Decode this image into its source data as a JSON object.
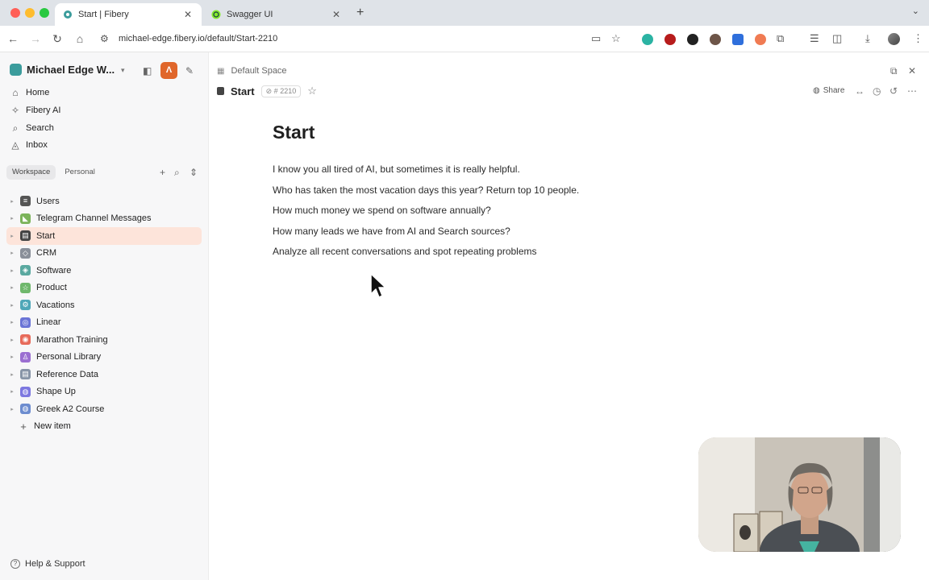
{
  "browser": {
    "tabs": [
      {
        "title": "Start | Fibery",
        "close": "✕"
      },
      {
        "title": "Swagger UI",
        "close": "✕"
      }
    ],
    "new_tab": "+",
    "url": "michael-edge.fibery.io/default/Start-2210"
  },
  "sidebar": {
    "workspace_name": "Michael Edge W...",
    "ai_button": "Λ",
    "menu": [
      {
        "label": "Home",
        "icon": "home-icon"
      },
      {
        "label": "Fibery AI",
        "icon": "sparkle-icon"
      },
      {
        "label": "Search",
        "icon": "search-icon"
      },
      {
        "label": "Inbox",
        "icon": "bell-icon"
      }
    ],
    "tabs": {
      "workspace": "Workspace",
      "personal": "Personal"
    },
    "tree": [
      {
        "label": "Users",
        "color": "#555555"
      },
      {
        "label": "Telegram Channel Messages",
        "color": "#7bb35a"
      },
      {
        "label": "Start",
        "color": "#444444"
      },
      {
        "label": "CRM",
        "color": "#8a8f99"
      },
      {
        "label": "Software",
        "color": "#5aa9a0"
      },
      {
        "label": "Product",
        "color": "#6fb86c"
      },
      {
        "label": "Vacations",
        "color": "#4fa7b8"
      },
      {
        "label": "Linear",
        "color": "#6a74d6"
      },
      {
        "label": "Marathon Training",
        "color": "#e76a5a"
      },
      {
        "label": "Personal Library",
        "color": "#9b6fd1"
      },
      {
        "label": "Reference Data",
        "color": "#8895a7"
      },
      {
        "label": "Shape Up",
        "color": "#7d78e0"
      },
      {
        "label": "Greek A2 Course",
        "color": "#6c8ccf"
      }
    ],
    "new_item": "New item",
    "help": "Help & Support"
  },
  "main": {
    "breadcrumb": "Default Space",
    "title": "Start",
    "id_badge": "2210",
    "share": "Share",
    "page_title": "Start",
    "paragraphs": [
      "I know you all tired of AI, but sometimes it is really helpful.",
      "Who has taken the most vacation days this year? Return top 10 people.",
      "How much money we spend on software annually?",
      "How many leads we have from AI and Search sources?",
      "Analyze all recent conversations and spot repeating problems"
    ]
  },
  "colors": {
    "accent": "#e0662a",
    "selected": "#fde4da",
    "brand": "#3b9c9c"
  }
}
